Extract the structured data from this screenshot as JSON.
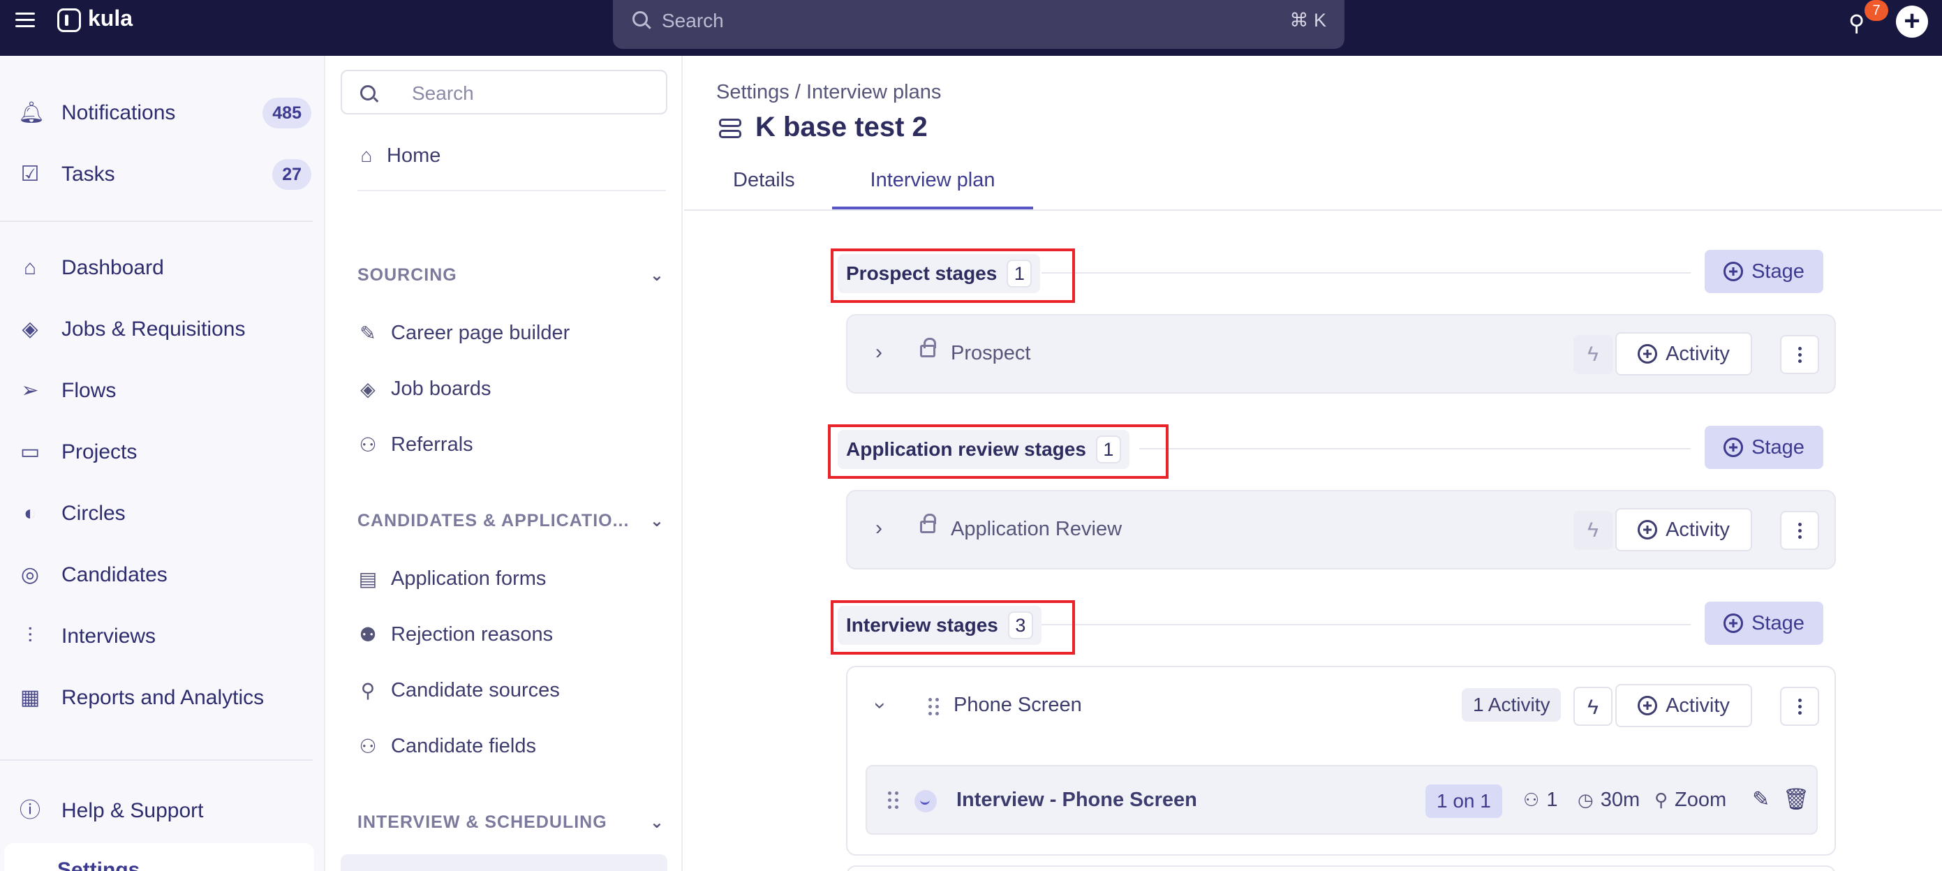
{
  "app": {
    "name": "kula"
  },
  "top_search": {
    "placeholder": "Search",
    "shortcut": "⌘ K"
  },
  "top_notifications_badge": "7",
  "sidebar": {
    "items": [
      {
        "label": "Notifications",
        "count": "485",
        "icon": "bell-icon"
      },
      {
        "label": "Tasks",
        "count": "27",
        "icon": "calendar-check-icon"
      },
      {
        "label": "Dashboard",
        "icon": "home-icon"
      },
      {
        "label": "Jobs & Requisitions",
        "icon": "layers-icon"
      },
      {
        "label": "Flows",
        "icon": "send-icon"
      },
      {
        "label": "Projects",
        "icon": "folder-icon"
      },
      {
        "label": "Circles",
        "icon": "circles-icon"
      },
      {
        "label": "Candidates",
        "icon": "user-circle-icon"
      },
      {
        "label": "Interviews",
        "icon": "waveform-icon"
      },
      {
        "label": "Reports and Analytics",
        "icon": "chart-icon"
      },
      {
        "label": "Help & Support",
        "icon": "help-icon"
      },
      {
        "label": "Settings",
        "icon": "gear-icon"
      }
    ]
  },
  "settings_nav": {
    "search_placeholder": "Search",
    "home": "Home",
    "sections": [
      {
        "title": "SOURCING",
        "items": [
          "Career page builder",
          "Job boards",
          "Referrals"
        ]
      },
      {
        "title": "CANDIDATES & APPLICATIO...",
        "items": [
          "Application forms",
          "Rejection reasons",
          "Candidate sources",
          "Candidate fields"
        ]
      },
      {
        "title": "INTERVIEW & SCHEDULING",
        "items": []
      }
    ]
  },
  "main": {
    "breadcrumb": "Settings / Interview plans",
    "title": "K base test 2",
    "tabs": [
      {
        "label": "Details",
        "active": false
      },
      {
        "label": "Interview plan",
        "active": true
      }
    ],
    "stage_button_label": "Stage",
    "activity_button_label": "Activity",
    "groups": [
      {
        "name": "Prospect stages",
        "count": "1",
        "stages": [
          {
            "name": "Prospect",
            "locked": true,
            "expanded": false
          }
        ]
      },
      {
        "name": "Application review stages",
        "count": "1",
        "stages": [
          {
            "name": "Application Review",
            "locked": true,
            "expanded": false
          }
        ]
      },
      {
        "name": "Interview stages",
        "count": "3",
        "stages": [
          {
            "name": "Phone Screen",
            "locked": false,
            "expanded": true,
            "activity_count": "1 Activity",
            "activities": [
              {
                "name": "Interview - Phone Screen",
                "type": "1 on 1",
                "interviewers": "1",
                "duration": "30m",
                "location": "Zoom"
              }
            ]
          }
        ]
      }
    ]
  },
  "colors": {
    "topbar": "#17173f",
    "accent": "#5855c6",
    "highlight": "#e8232a",
    "badge": "#f05a2b"
  }
}
